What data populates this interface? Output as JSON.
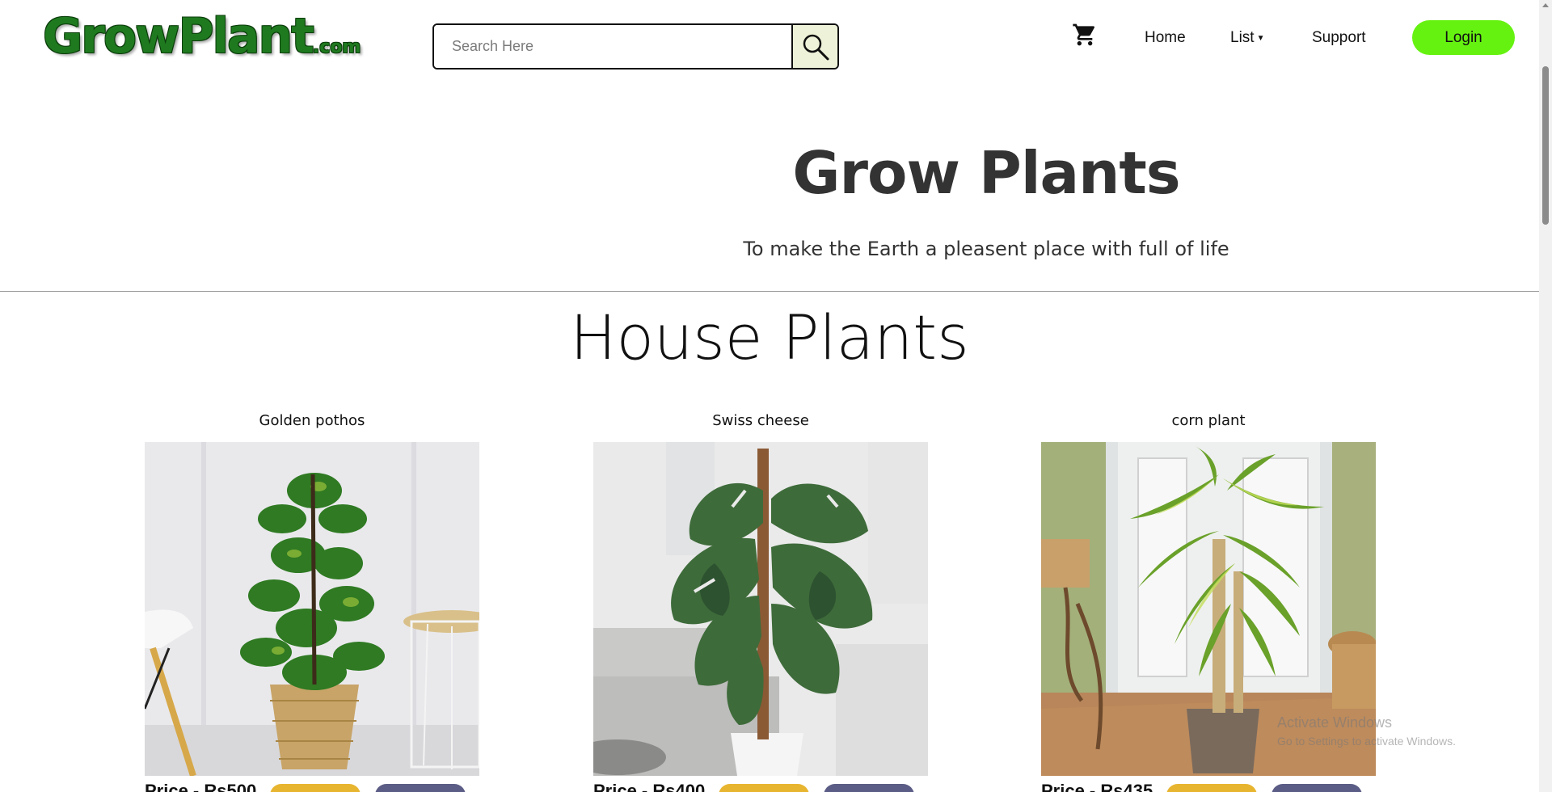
{
  "header": {
    "logo_main": "GrowPlant",
    "logo_sub": ".com",
    "search_placeholder": "Search Here",
    "nav": {
      "home": "Home",
      "list": "List",
      "support": "Support"
    },
    "login_label": "Login",
    "icons": [
      "search-icon",
      "cart-icon",
      "caret-down-icon"
    ]
  },
  "hero": {
    "title": "Grow Plants",
    "subtitle": "To make the Earth a pleasent place with full of life"
  },
  "section": {
    "title": "House Plants"
  },
  "products": [
    {
      "name": "Golden pothos",
      "price": "Price - Rs500"
    },
    {
      "name": "Swiss cheese",
      "price": "Price - Rs400"
    },
    {
      "name": "corn plant",
      "price": "Price - Rs435"
    }
  ],
  "watermark": {
    "title": "Activate Windows",
    "subtitle": "Go to Settings to activate Windows."
  },
  "colors": {
    "logo_green": "#1f7a1f",
    "login_green": "#66f211",
    "add_cart_yellow": "#e8b530",
    "buy_slate": "#5c5d86",
    "search_button_bg": "#eef2d8"
  }
}
